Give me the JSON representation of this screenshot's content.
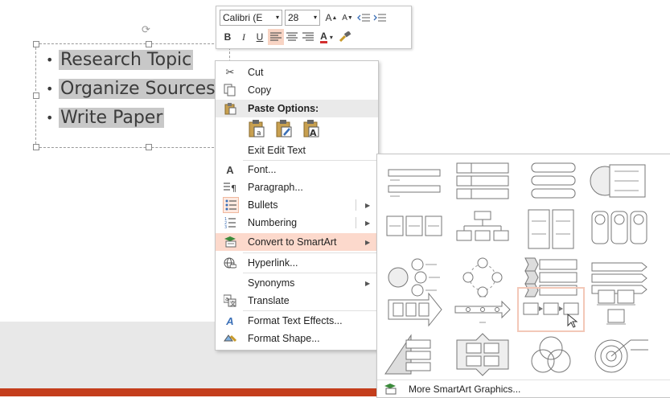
{
  "slide": {
    "bullets": [
      "Research Topic",
      "Organize Sources",
      "Write Paper"
    ],
    "bullet_char": "•"
  },
  "minitoolbar": {
    "font_name": "Calibri (E",
    "font_size": "28",
    "bold": "B",
    "italic": "I",
    "underline": "U",
    "font_color_label": "A",
    "grow_font": "A",
    "shrink_font": "A"
  },
  "context_menu": {
    "cut": "Cut",
    "copy": "Copy",
    "paste_options": "Paste Options:",
    "exit_edit_text": "Exit Edit Text",
    "font": "Font...",
    "paragraph": "Paragraph...",
    "bullets": "Bullets",
    "numbering": "Numbering",
    "convert_smartart": "Convert to SmartArt",
    "hyperlink": "Hyperlink...",
    "synonyms": "Synonyms",
    "translate": "Translate",
    "format_text_effects": "Format Text Effects...",
    "format_shape": "Format Shape..."
  },
  "smartart_gallery": {
    "more_graphics": "More SmartArt Graphics..."
  },
  "colors": {
    "accent": "#c43e1c",
    "highlight": "#fcd9cc",
    "icon_gray": "#7a7a7a"
  }
}
